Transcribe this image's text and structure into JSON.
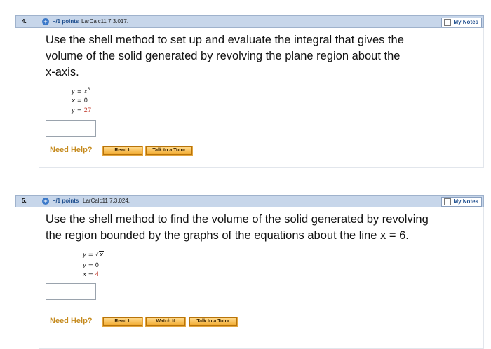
{
  "questions": [
    {
      "number": "4.",
      "points": "–/1 points",
      "source": "LarCalc11 7.3.017.",
      "my_notes": "My Notes",
      "prompt_lines": [
        "Use the shell method to set up and evaluate the integral that gives the",
        "volume of the solid generated by revolving the plane region about the",
        "x-axis."
      ],
      "equations": [
        {
          "lhs": "y",
          "rhs": "x",
          "exp": "3"
        },
        {
          "lhs": "x",
          "rhs": "0"
        },
        {
          "lhs": "y",
          "rhs": "27"
        }
      ],
      "answer_value": "",
      "need_help": "Need Help?",
      "buttons": [
        "Read It",
        "Talk to a Tutor"
      ]
    },
    {
      "number": "5.",
      "points": "–/1 points",
      "source": "LarCalc11 7.3.024.",
      "my_notes": "My Notes",
      "prompt_lines": [
        "Use the shell method to find the volume of the solid generated by revolving",
        "the region bounded by the graphs of the equations about the line x = 6."
      ],
      "equations": [
        {
          "lhs": "y",
          "rhs": "x",
          "sqrt": true
        },
        {
          "lhs": "y",
          "rhs": "0"
        },
        {
          "lhs": "x",
          "rhs": "4"
        }
      ],
      "answer_value": "",
      "need_help": "Need Help?",
      "buttons": [
        "Read It",
        "Watch It",
        "Talk to a Tutor"
      ]
    }
  ],
  "colors": {
    "header_bar": "#c7d6ea",
    "points_text": "#1f4f8f",
    "red_value": "#c0392b",
    "need_help": "#c58a1d",
    "button": "#f2ad35"
  },
  "icons": [
    "plus-circle-icon",
    "checkbox-icon"
  ]
}
